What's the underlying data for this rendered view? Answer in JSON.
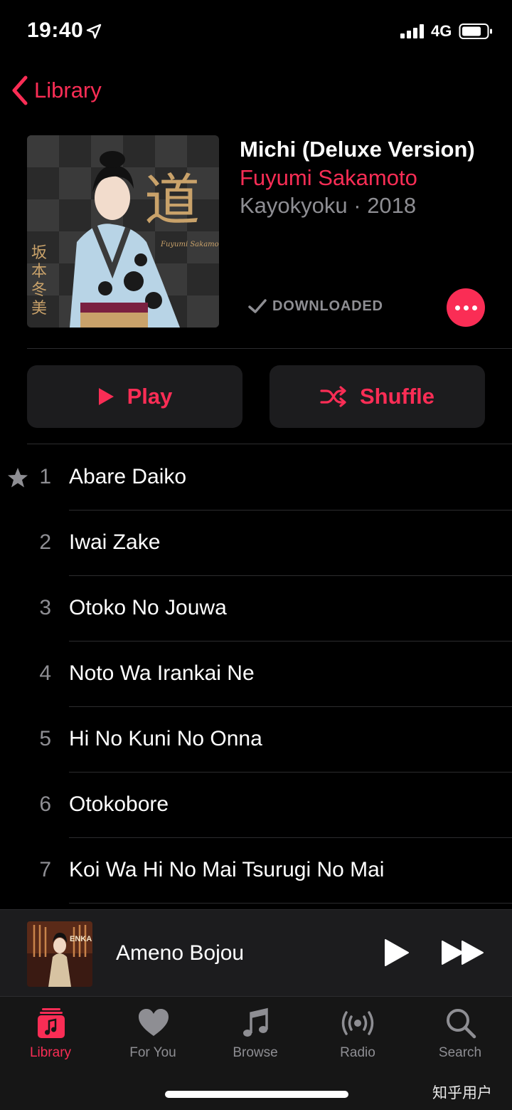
{
  "status_bar": {
    "time": "19:40",
    "network": "4G",
    "icons": [
      "location-arrow-icon",
      "signal-bars-icon",
      "battery-icon"
    ]
  },
  "nav": {
    "back_label": "Library",
    "back_icon": "chevron-left-icon"
  },
  "album": {
    "title": "Michi (Deluxe Version)",
    "artist": "Fuyumi Sakamoto",
    "meta": "Kayokyoku · 2018",
    "download_status": "DOWNLOADED",
    "cover_art": {
      "kanji_title": "道",
      "kanji_artist": [
        "坂",
        "本",
        "冬",
        "美"
      ],
      "signature": "Fuyumi Sakamoto"
    }
  },
  "actions": {
    "play_label": "Play",
    "shuffle_label": "Shuffle"
  },
  "tracks": [
    {
      "number": "1",
      "title": "Abare Daiko",
      "starred": true
    },
    {
      "number": "2",
      "title": "Iwai Zake",
      "starred": false
    },
    {
      "number": "3",
      "title": "Otoko No Jouwa",
      "starred": false
    },
    {
      "number": "4",
      "title": "Noto Wa Irankai Ne",
      "starred": false
    },
    {
      "number": "5",
      "title": "Hi No Kuni No Onna",
      "starred": false
    },
    {
      "number": "6",
      "title": "Otokobore",
      "starred": false
    },
    {
      "number": "7",
      "title": "Koi Wa Hi No Mai Tsurugi No Mai",
      "starred": false
    }
  ],
  "now_playing": {
    "title": "Ameno Bojou",
    "art_text": "ENKA"
  },
  "tab_bar": {
    "tabs": [
      {
        "label": "Library",
        "icon": "library-icon",
        "active": true
      },
      {
        "label": "For You",
        "icon": "heart-icon",
        "active": false
      },
      {
        "label": "Browse",
        "icon": "music-note-icon",
        "active": false
      },
      {
        "label": "Radio",
        "icon": "radio-broadcast-icon",
        "active": false
      },
      {
        "label": "Search",
        "icon": "search-icon",
        "active": false
      }
    ]
  },
  "watermark": "知乎用户",
  "colors": {
    "accent": "#fa2d55",
    "background": "#000000",
    "secondary_text": "#8e8e93",
    "surface": "#1c1c1e"
  }
}
